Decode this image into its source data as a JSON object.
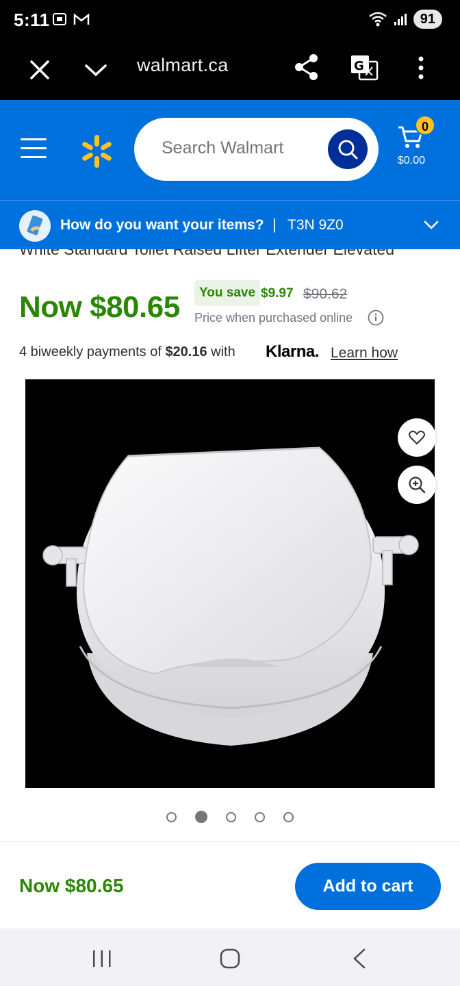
{
  "status_bar": {
    "time": "5:11",
    "battery": "91"
  },
  "browser": {
    "url": "walmart.ca"
  },
  "header": {
    "search_placeholder": "Search Walmart",
    "cart_count": "0",
    "cart_total": "$0.00",
    "brand_color": "#0071dc",
    "spark_color": "#ffc220"
  },
  "fulfillment": {
    "question": "How do you want your items?",
    "separator": "|",
    "postal_code": "T3N 9Z0"
  },
  "product": {
    "title_partial": "White Standard Toilet Raised Lifter Extender Elevated",
    "price_now": "Now $80.65",
    "you_save_label": "You save",
    "save_amount": "$9.97",
    "was_price": "$90.62",
    "online_note": "Price when purchased online",
    "klarna_prefix": "4 biweekly payments of ",
    "klarna_amount": "$20.16",
    "klarna_suffix": " with",
    "klarna_brand": "Klarna.",
    "learn_how": "Learn how",
    "gallery_total": 5,
    "gallery_active_index": 1
  },
  "bottom_bar": {
    "price": "Now $80.65",
    "add_to_cart": "Add to cart"
  }
}
